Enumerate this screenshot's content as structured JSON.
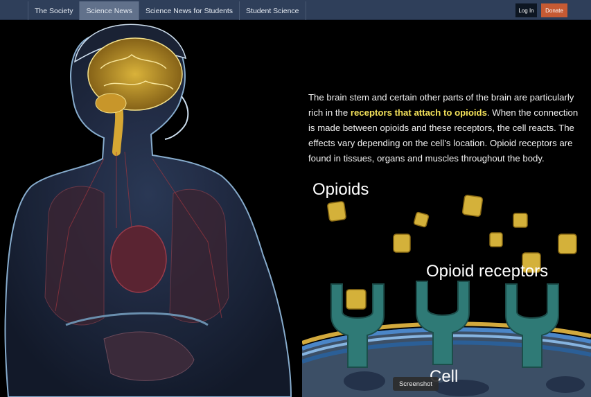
{
  "nav": {
    "items": [
      {
        "label": "The Society"
      },
      {
        "label": "Science News",
        "active": true
      },
      {
        "label": "Science News for Students"
      },
      {
        "label": "Student Science"
      }
    ],
    "login_label": "Log In",
    "donate_label": "Donate"
  },
  "article": {
    "text_before": "The brain stem and certain other parts of the brain are particularly rich in the ",
    "highlight": "receptors that attach to opioids",
    "text_after": ". When the connection is made between opioids and these receptors, the cell reacts. The effects vary depending on the cell’s location. Opioid receptors are found in tissues, organs and muscles throughout the body."
  },
  "diagram": {
    "opioids_label": "Opioids",
    "receptors_label": "Opioid receptors",
    "cell_label": "Cell"
  },
  "tooltip": {
    "label": "Screenshot"
  },
  "colors": {
    "nav_bg": "#2f3f5a",
    "nav_active": "#61718b",
    "donate": "#c65a33",
    "highlight": "#f3e15a",
    "opioid": "#d4b13a",
    "receptor": "#2f7a76"
  }
}
